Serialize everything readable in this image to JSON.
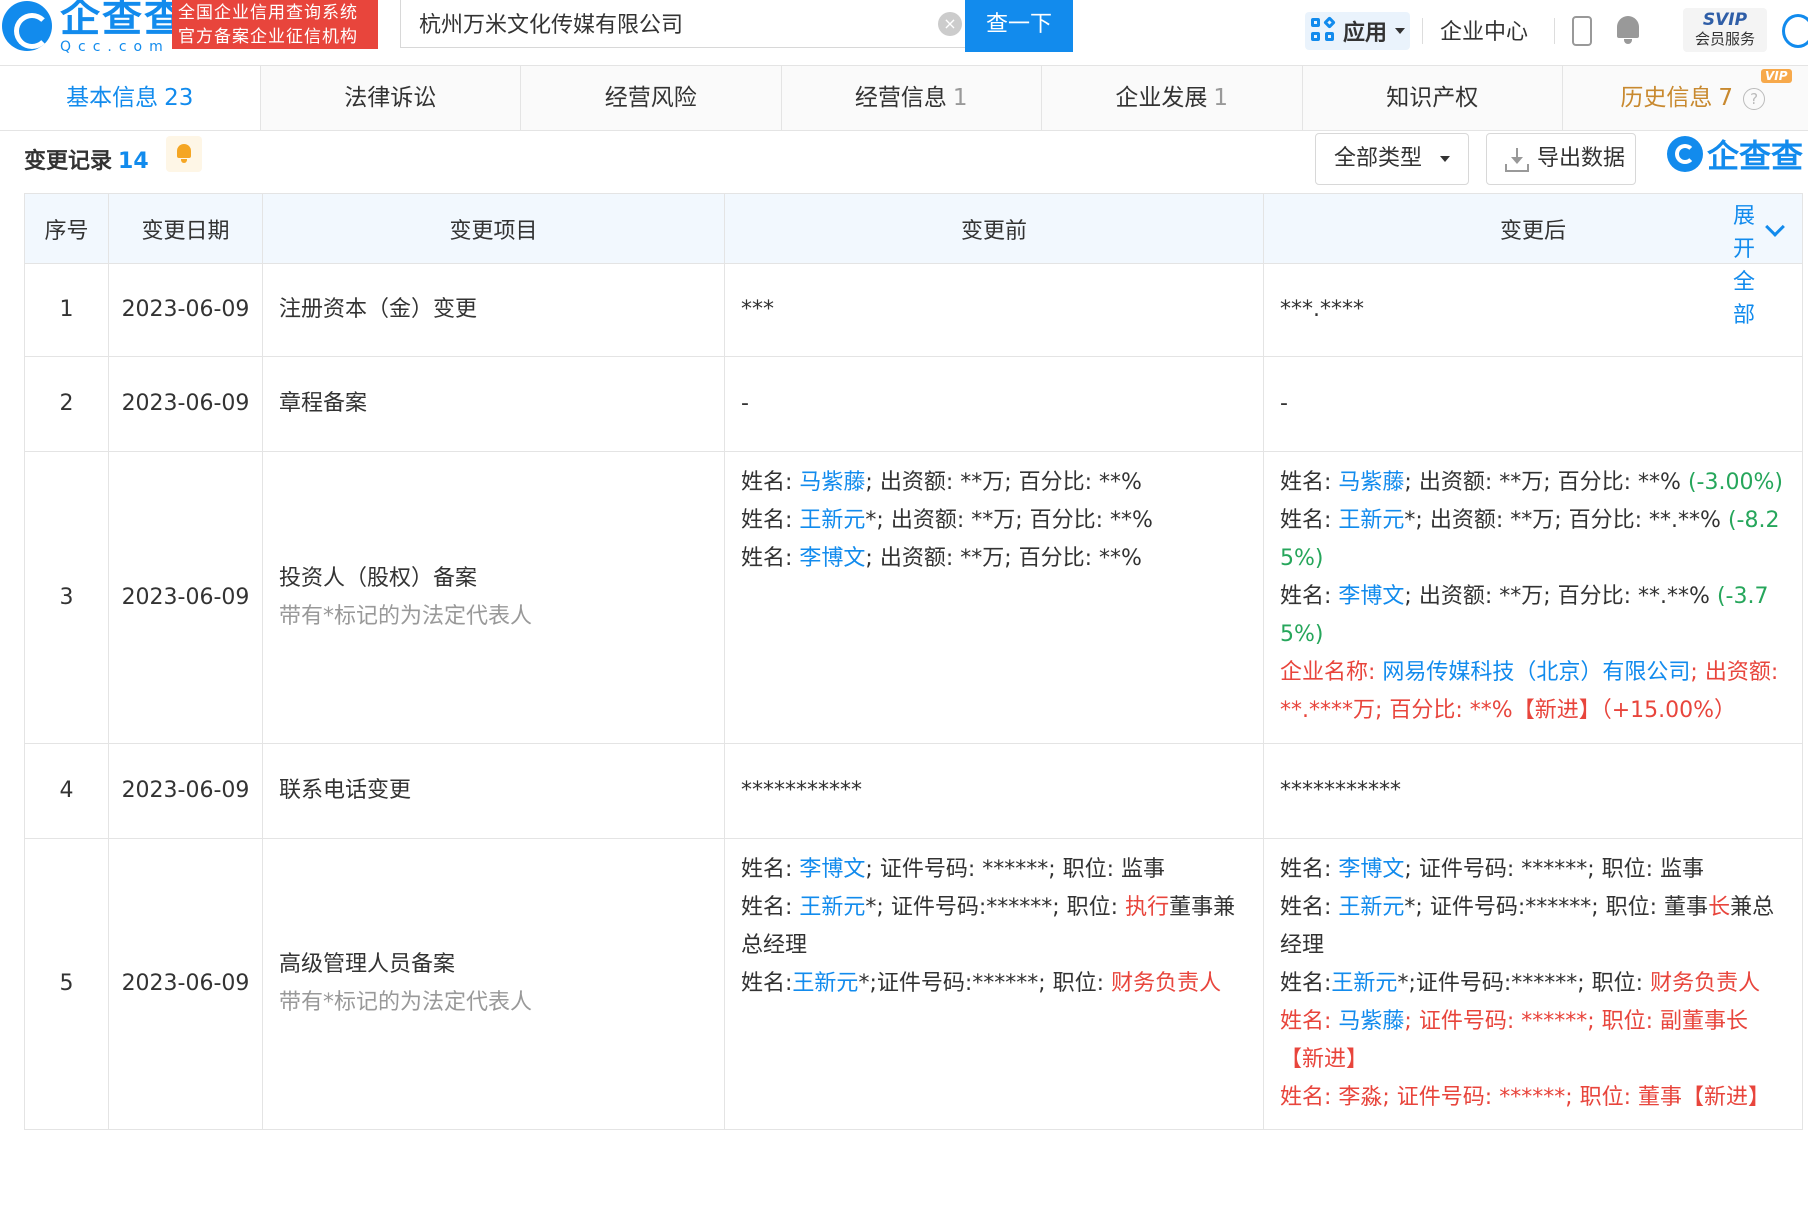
{
  "header": {
    "logo_cn": "企查查",
    "logo_en": "Qcc.com",
    "badge_line1": "全国企业信用查询系统",
    "badge_line2": "官方备案企业征信机构",
    "search_value": "杭州万米文化传媒有限公司",
    "clear_icon": "×",
    "search_button": "查一下",
    "apps_label": "应用",
    "enterprise_center": "企业中心",
    "svip_label": "SVIP",
    "svip_sub": "会员服务"
  },
  "tabs": [
    {
      "label": "基本信息",
      "count": "23"
    },
    {
      "label": "法律诉讼",
      "count": ""
    },
    {
      "label": "经营风险",
      "count": ""
    },
    {
      "label": "经营信息",
      "count": "1"
    },
    {
      "label": "企业发展",
      "count": "1"
    },
    {
      "label": "知识产权",
      "count": ""
    },
    {
      "label": "历史信息",
      "count": "7",
      "flag": "VIP"
    }
  ],
  "section": {
    "title": "变更记录",
    "count": "14",
    "type_filter": "全部类型",
    "export_label": "导出数据",
    "watermark": "企查查"
  },
  "table": {
    "headers": {
      "index": "序号",
      "date": "变更日期",
      "item": "变更项目",
      "before": "变更前",
      "after": "变更后",
      "expand": "展开全部"
    },
    "rows": [
      {
        "index": "1",
        "date": "2023-06-09",
        "item": "注册资本（金）变更",
        "before": "***",
        "after": "***.****"
      },
      {
        "index": "2",
        "date": "2023-06-09",
        "item": "章程备案",
        "before": "-",
        "after": "-"
      },
      {
        "index": "3",
        "date": "2023-06-09",
        "item": "投资人（股权）备案",
        "note": "带有*标记的为法定代表人",
        "before": [
          {
            "p": "姓名: ",
            "name": "马紫藤",
            "s": "; 出资额: **万; 百分比: **%"
          },
          {
            "p": "姓名: ",
            "name": "王新元",
            "s": "*; 出资额: **万; 百分比: **%"
          },
          {
            "p": "姓名: ",
            "name": "李博文",
            "s": "; 出资额: **万; 百分比: **%"
          }
        ],
        "after": [
          {
            "p": "姓名: ",
            "name": "马紫藤",
            "s": "; 出资额: **万; 百分比: **%",
            "delta": "(-3.00%)"
          },
          {
            "p": "姓名: ",
            "name": "王新元",
            "s": "*; 出资额: **万; 百分比: **.**%",
            "delta": "(-8.25%)"
          },
          {
            "p": "姓名: ",
            "name": "李博文",
            "s": "; 出资额: **万; 百分比: **.**%",
            "delta": "(-3.75%)"
          },
          {
            "p": "企业名称: ",
            "name": "网易传媒科技（北京）有限公司",
            "s": "; 出资额: **.****万; 百分比: **%【新进】（+15.00%）",
            "new": true
          }
        ]
      },
      {
        "index": "4",
        "date": "2023-06-09",
        "item": "联系电话变更",
        "before": "***********",
        "after": "***********"
      },
      {
        "index": "5",
        "date": "2023-06-09",
        "item": "高级管理人员备案",
        "note": "带有*标记的为法定代表人",
        "before": [
          {
            "p": "姓名: ",
            "name": "李博文",
            "s": "; 证件号码: ******; 职位: 监事"
          },
          {
            "p": "姓名: ",
            "name": "王新元",
            "s": "*; 证件号码:******; 职位: ",
            "role": "执行",
            "s2": "董事兼总经理"
          },
          {
            "p": "姓名:",
            "name": "王新元",
            "s": "*;证件号码:******; 职位: ",
            "role": "财务负责人"
          }
        ],
        "after": [
          {
            "p": "姓名: ",
            "name": "李博文",
            "s": "; 证件号码: ******; 职位: 监事"
          },
          {
            "p": "姓名: ",
            "name": "王新元",
            "s": "*; 证件号码:******; 职位: 董事",
            "role": "长",
            "s2": "兼总经理"
          },
          {
            "p": "姓名:",
            "name": "王新元",
            "s": "*;证件号码:******; 职位: ",
            "role": "财务负责人"
          },
          {
            "p": "姓名: ",
            "name": "马紫藤",
            "s": "; 证件号码: ******; 职位: 副董事长【新进】",
            "new": true
          },
          {
            "p": "姓名: 李淼; 证件号码: ******; 职位: 董事【新进】",
            "new": true
          }
        ]
      }
    ]
  },
  "colors": {
    "brand": "#128bed",
    "red": "#e8453c",
    "green": "#26a65b",
    "vip": "#c8892f"
  }
}
